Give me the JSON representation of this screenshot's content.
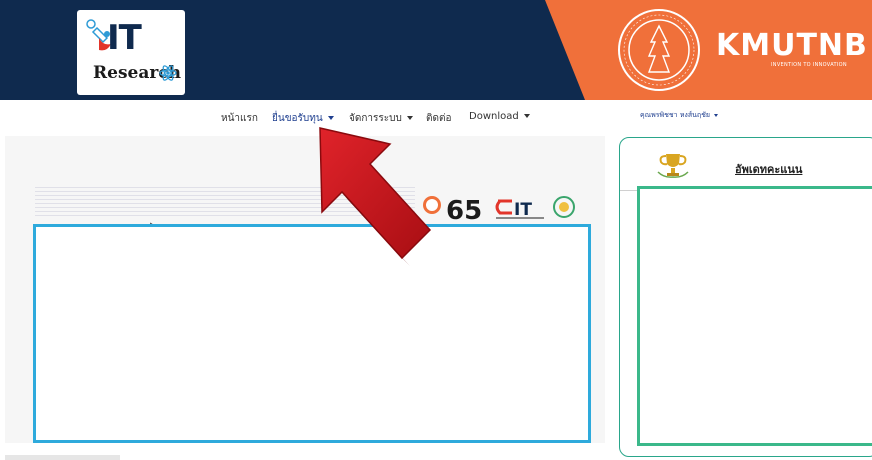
{
  "header": {
    "logo_it": "IT",
    "logo_research": "Research",
    "brand": "KMUTNB",
    "brand_tagline": "INVENTION TO INNOVATION"
  },
  "nav": {
    "items": [
      {
        "label": "หน้าแรก",
        "has_caret": false
      },
      {
        "label": "ยื่นขอรับทุน",
        "has_caret": true,
        "active": true
      },
      {
        "label": "จัดการระบบ",
        "has_caret": true
      },
      {
        "label": "ติดต่อ",
        "has_caret": false
      },
      {
        "label": "Download",
        "has_caret": true
      }
    ],
    "user": "คุณพรพิชชา หงส์นฤชัย"
  },
  "right_panel": {
    "title": "อัพเดทคะแนน"
  },
  "colors": {
    "banner_navy": "#0f2a4e",
    "banner_orange": "#f0703a",
    "blue_box": "#2eaadc",
    "green_box": "#3bb88a",
    "arrow_red": "#c0141a"
  }
}
